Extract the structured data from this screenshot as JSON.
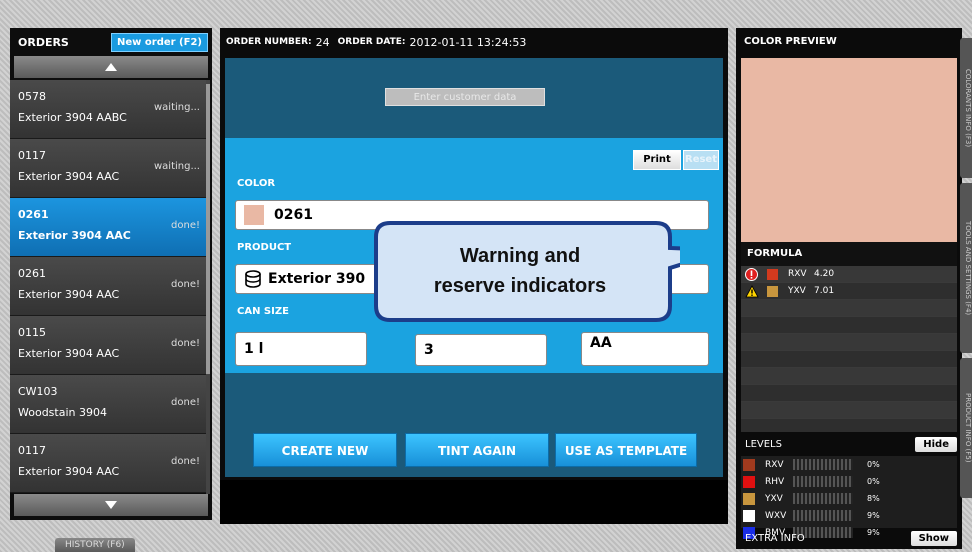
{
  "orders": {
    "title": "ORDERS",
    "new_order": "New order (F2)",
    "items": [
      {
        "number": "0578",
        "product": "Exterior 3904 AABC",
        "status": "waiting..."
      },
      {
        "number": "0117",
        "product": "Exterior 3904 AAC",
        "status": "waiting..."
      },
      {
        "number": "0261",
        "product": "Exterior 3904 AAC",
        "status": "done!"
      },
      {
        "number": "0261",
        "product": "Exterior 3904 AAC",
        "status": "done!"
      },
      {
        "number": "0115",
        "product": "Exterior 3904 AAC",
        "status": "done!"
      },
      {
        "number": "CW103",
        "product": "Woodstain 3904",
        "status": "done!"
      },
      {
        "number": "0117",
        "product": "Exterior 3904 AAC",
        "status": "done!"
      }
    ],
    "selected_index": 2,
    "history": "HISTORY (F6)"
  },
  "order_header": {
    "number_label": "ORDER NUMBER:",
    "number_value": "24",
    "date_label": "ORDER DATE:",
    "date_value": "2012-01-11 13:24:53"
  },
  "form": {
    "customer_button": "Enter customer data",
    "print": "Print",
    "reset": "Reset",
    "color_label": "COLOR",
    "color_value": "0261",
    "color_swatch": "#e9b8a4",
    "product_label": "PRODUCT",
    "product_value": "Exterior 390",
    "can_size_label": "CAN SIZE",
    "can_size_value": "1 l",
    "quantity_value": "3",
    "base_value": "AA"
  },
  "actions": {
    "create_new": "CREATE NEW",
    "tint_again": "TINT AGAIN",
    "use_as_template": "USE AS TEMPLATE"
  },
  "callout": {
    "line1": "Warning and",
    "line2": "reserve indicators"
  },
  "right": {
    "preview_title": "COLOR PREVIEW",
    "preview_color": "#e9b8a4",
    "formula_title": "FORMULA",
    "formula_rows": [
      {
        "icon": "error-icon",
        "color": "#d23a1e",
        "code": "RXV",
        "amount": "4.20"
      },
      {
        "icon": "warning-icon",
        "color": "#c8963e",
        "code": "YXV",
        "amount": "7.01"
      }
    ],
    "levels_title": "LEVELS",
    "hide": "Hide",
    "levels": [
      {
        "color": "#a03a1e",
        "code": "RXV",
        "pct": "0%"
      },
      {
        "color": "#e01010",
        "code": "RHV",
        "pct": "0%"
      },
      {
        "color": "#c8963e",
        "code": "YXV",
        "pct": "8%"
      },
      {
        "color": "#ffffff",
        "code": "WXV",
        "pct": "9%"
      },
      {
        "color": "#1a2ee8",
        "code": "BMV",
        "pct": "9%"
      }
    ],
    "extra_info": "EXTRA INFO",
    "show": "Show",
    "side_tabs": [
      "COLORANTS INFO (F3)",
      "TOOLS AND SETTINGS (F4)",
      "PRODUCT INFO (F5)"
    ]
  }
}
